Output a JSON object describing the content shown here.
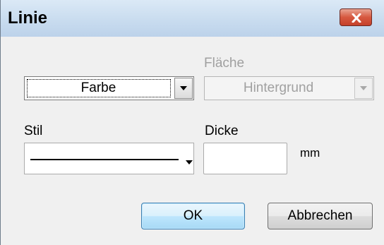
{
  "window": {
    "title": "Linie"
  },
  "fill_section": {
    "label": "Fläche"
  },
  "color_combo": {
    "value": "Farbe"
  },
  "fill_combo": {
    "value": "Hintergrund"
  },
  "style_section": {
    "label": "Stil"
  },
  "thickness": {
    "label": "Dicke",
    "value": "",
    "unit": "mm"
  },
  "buttons": {
    "ok": "OK",
    "cancel": "Abbrechen"
  },
  "icons": {
    "close": "close-icon",
    "dropdown": "chevron-down-icon"
  }
}
